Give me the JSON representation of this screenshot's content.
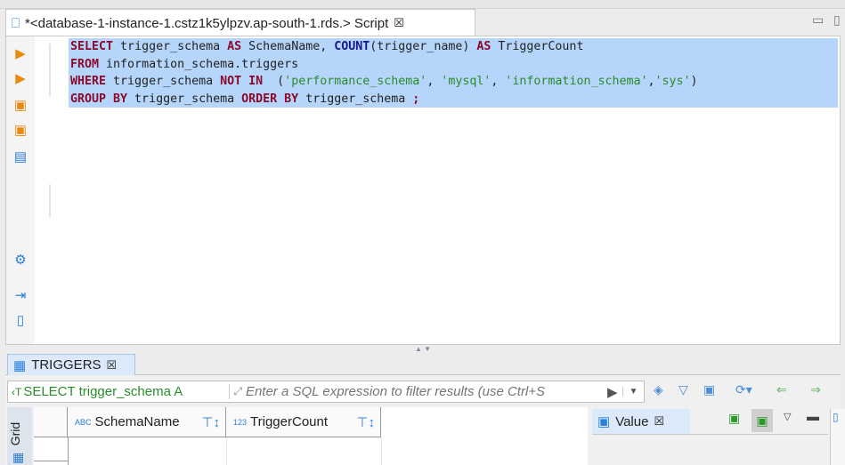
{
  "editor_tab": {
    "title": "*<database-1-instance-1.cstz1k5ylpzv.ap-south-1.rds.> Script",
    "close": "☒"
  },
  "code": {
    "l1": [
      {
        "t": "SELECT",
        "c": "kw"
      },
      {
        "t": " trigger_schema ",
        "c": ""
      },
      {
        "t": "AS",
        "c": "kw"
      },
      {
        "t": " SchemaName, ",
        "c": ""
      },
      {
        "t": "COUNT",
        "c": "fn"
      },
      {
        "t": "(trigger_name) ",
        "c": ""
      },
      {
        "t": "AS",
        "c": "kw"
      },
      {
        "t": " TriggerCount",
        "c": ""
      }
    ],
    "l2": [
      {
        "t": "FROM",
        "c": "kw"
      },
      {
        "t": " information_schema.triggers",
        "c": ""
      }
    ],
    "l3": [
      {
        "t": "WHERE",
        "c": "kw"
      },
      {
        "t": " trigger_schema ",
        "c": ""
      },
      {
        "t": "NOT IN",
        "c": "kw"
      },
      {
        "t": "  (",
        "c": ""
      },
      {
        "t": "'performance_schema'",
        "c": "str"
      },
      {
        "t": ", ",
        "c": ""
      },
      {
        "t": "'mysql'",
        "c": "str"
      },
      {
        "t": ", ",
        "c": ""
      },
      {
        "t": "'information_schema'",
        "c": "str"
      },
      {
        "t": ",",
        "c": ""
      },
      {
        "t": "'sys'",
        "c": "str"
      },
      {
        "t": ")",
        "c": ""
      }
    ],
    "l4": [
      {
        "t": "GROUP BY",
        "c": "kw"
      },
      {
        "t": " trigger_schema ",
        "c": ""
      },
      {
        "t": "ORDER BY",
        "c": "kw"
      },
      {
        "t": " trigger_schema ",
        "c": ""
      },
      {
        "t": ";",
        "c": "kw"
      }
    ]
  },
  "results_tab": {
    "label": "TRIGGERS",
    "close": "☒"
  },
  "filter": {
    "query": "SELECT trigger_schema A",
    "placeholder": "Enter a SQL expression to filter results (use Ctrl+S"
  },
  "grid": {
    "side_label": "Grid",
    "columns": [
      {
        "type": "ABC",
        "name": "SchemaName"
      },
      {
        "type": "123",
        "name": "TriggerCount"
      }
    ]
  },
  "value_panel": {
    "label": "Value",
    "close": "☒"
  }
}
